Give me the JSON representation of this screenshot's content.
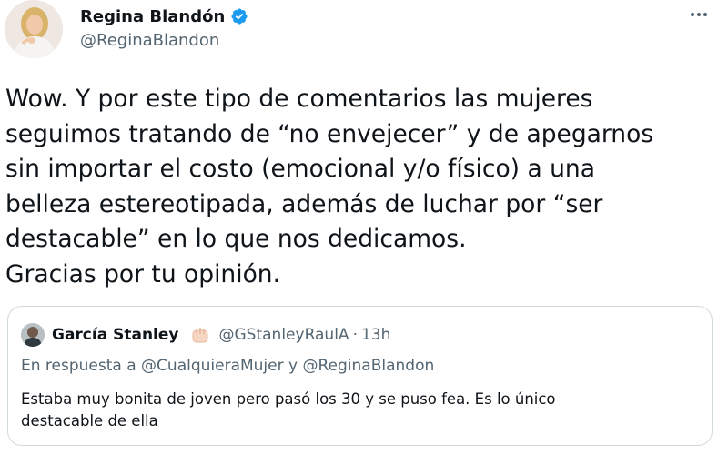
{
  "author": {
    "name": "Regina Blandón",
    "handle": "@ReginaBlandon",
    "verified": true,
    "avatar_icon": "profile-photo"
  },
  "tweet": {
    "lines": [
      "Wow. Y por este tipo de comentarios las mujeres",
      "seguimos tratando de “no envejecer” y de apegarnos",
      "sin importar el costo (emocional y/o físico) a una",
      "belleza estereotipada, además de luchar por “ser",
      "destacable” en lo que nos dedicamos.",
      "Gracias por tu opinión."
    ]
  },
  "quoted": {
    "name": "García Stanley",
    "emoji_icon": "raised-fist-emoji-icon",
    "handle": "@GStanleyRaulA",
    "separator": "·",
    "time": "13h",
    "reply_prefix": "En respuesta a",
    "reply_mention_1": "@CualquieraMujer",
    "reply_joiner": "y",
    "reply_mention_2": "@ReginaBlandon",
    "text_lines": [
      "Estaba muy bonita de joven pero pasó los 30 y se puso fea. Es lo único",
      "destacable de ella"
    ]
  },
  "colors": {
    "text": "#0f1419",
    "secondary": "#536471",
    "verified": "#1d9bf0",
    "border": "#cfd9de"
  }
}
